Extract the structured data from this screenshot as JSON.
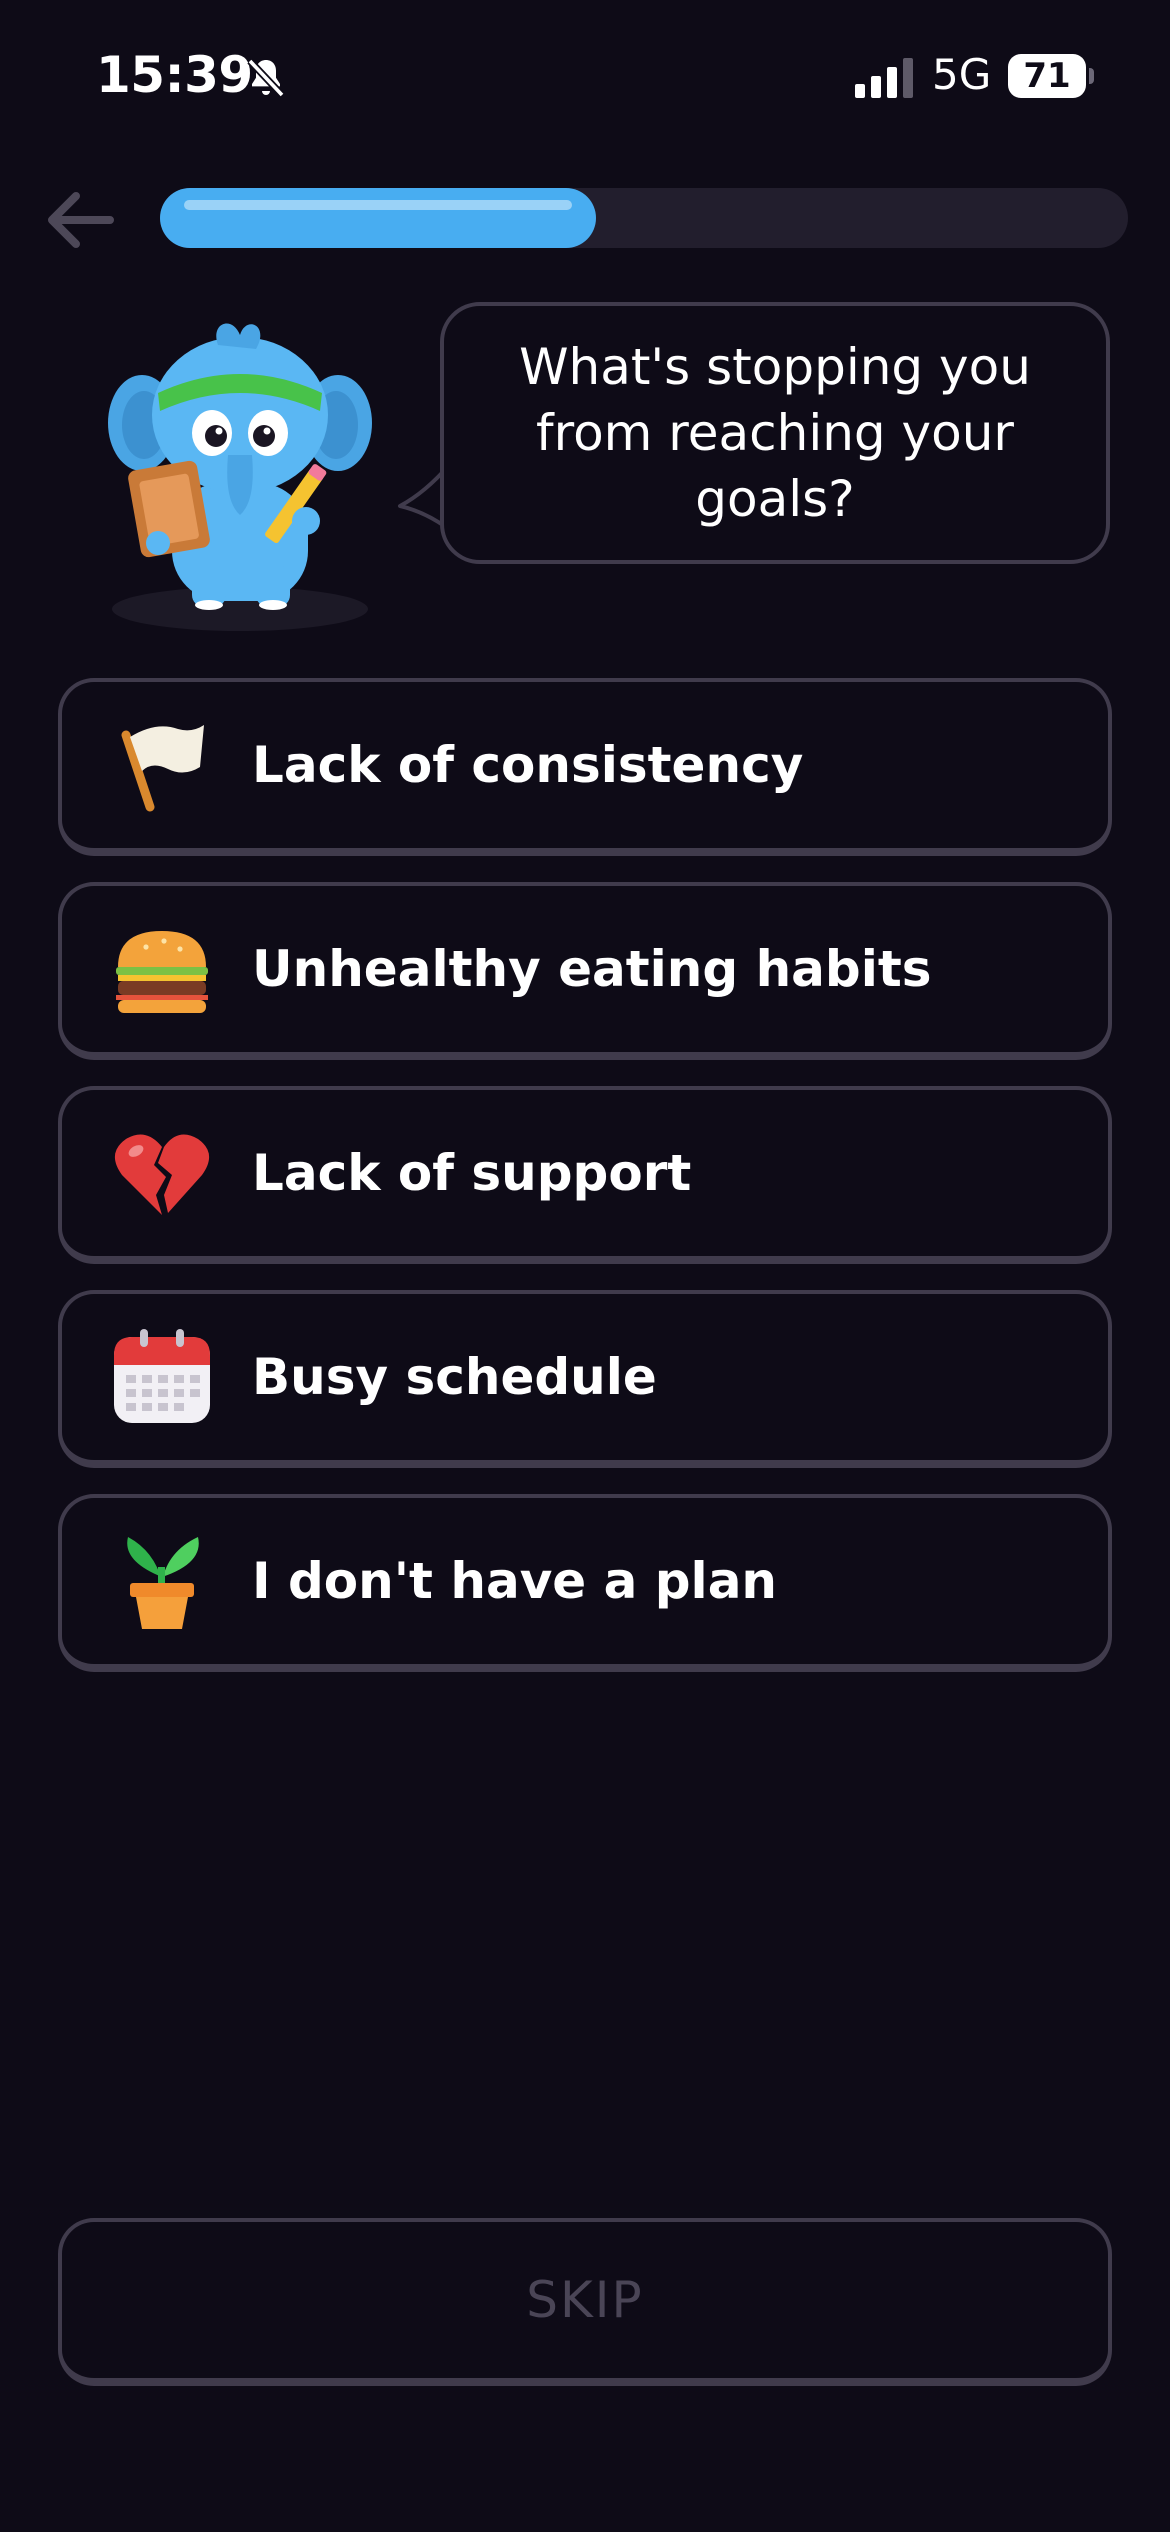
{
  "status_bar": {
    "time": "15:39",
    "network": "5G",
    "battery": "71"
  },
  "progress": {
    "fraction": 0.45
  },
  "prompt": {
    "question": "What's stopping you from reaching your goals?"
  },
  "options": [
    {
      "label": "Lack of consistency",
      "icon": "white-flag-icon"
    },
    {
      "label": "Unhealthy eating habits",
      "icon": "burger-icon"
    },
    {
      "label": "Lack of support",
      "icon": "broken-heart-icon"
    },
    {
      "label": "Busy schedule",
      "icon": "calendar-icon"
    },
    {
      "label": "I don't have a plan",
      "icon": "potted-sprout-icon"
    }
  ],
  "skip_label": "SKIP",
  "colors": {
    "background": "#0e0b17",
    "accent": "#48adf1",
    "border": "#403b4c",
    "muted": "#4a4556"
  }
}
